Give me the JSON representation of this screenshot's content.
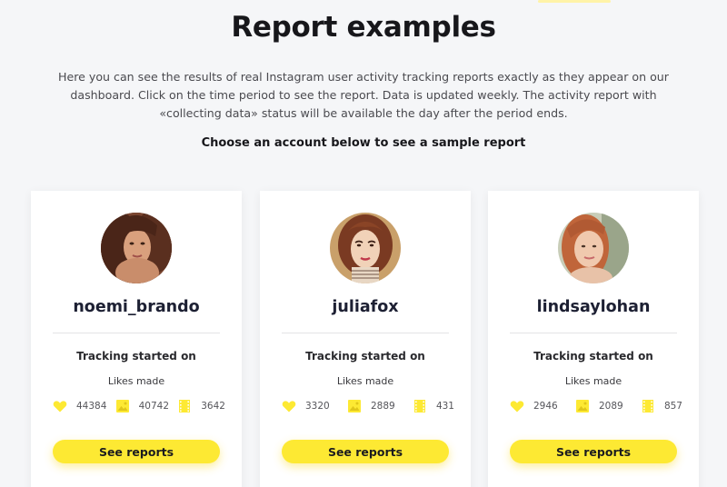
{
  "header": {
    "title": "Report examples",
    "intro_line1": "Here you can see the results of real Instagram user activity tracking reports exactly as they appear on our",
    "intro_line2": "dashboard. Click on the time period to see the report. Data is updated weekly. The activity report with",
    "intro_line3": "«collecting data» status will be available the day after the period ends.",
    "subhead": "Choose an account below to see a sample report"
  },
  "theme": {
    "accent": "#fde933",
    "icon_color": "#fde933",
    "background": "#f5f6f8",
    "card_bg": "#ffffff"
  },
  "cards": [
    {
      "username": "noemi_brando",
      "tracking_label": "Tracking started on",
      "likes_label": "Likes made",
      "stats": [
        {
          "icon": "heart-icon",
          "value": "44384"
        },
        {
          "icon": "image-icon",
          "value": "40742"
        },
        {
          "icon": "film-icon",
          "value": "3642"
        }
      ],
      "button_label": "See reports",
      "avatar": "woman-photo-avatar"
    },
    {
      "username": "juliafox",
      "tracking_label": "Tracking started on",
      "likes_label": "Likes made",
      "stats": [
        {
          "icon": "heart-icon",
          "value": "3320"
        },
        {
          "icon": "image-icon",
          "value": "2889"
        },
        {
          "icon": "film-icon",
          "value": "431"
        }
      ],
      "button_label": "See reports",
      "avatar": "illustrated-woman-avatar"
    },
    {
      "username": "lindsaylohan",
      "tracking_label": "Tracking started on",
      "likes_label": "Likes made",
      "stats": [
        {
          "icon": "heart-icon",
          "value": "2946"
        },
        {
          "icon": "image-icon",
          "value": "2089"
        },
        {
          "icon": "film-icon",
          "value": "857"
        }
      ],
      "button_label": "See reports",
      "avatar": "woman-photo-avatar"
    }
  ]
}
